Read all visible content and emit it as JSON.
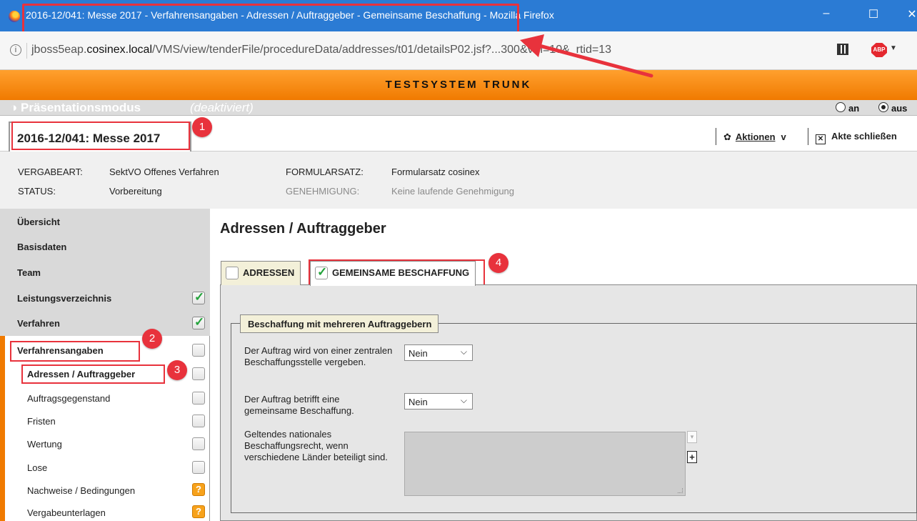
{
  "browser": {
    "window_title": "2016-12/041: Messe 2017 - Verfahrensangaben - Adressen / Auftraggeber - Gemeinsame Beschaffung - Mozilla Firefox",
    "window_buttons": {
      "minimize": "–",
      "maximize": "☐",
      "close": "✕"
    },
    "url_prefix": "jboss5eap.",
    "url_host": "cosinex.local",
    "url_path": "/VMS/view/tenderFile/procedureData/addresses/t01/detailsP02.jsf?...300&vm=10&_rtid=13",
    "info_icon": "ⓘ",
    "abp_label": "ABP"
  },
  "banner": {
    "text": "TESTSYSTEM TRUNK"
  },
  "presentation": {
    "label": "◑ Präsentationsmodus",
    "status": "(deaktiviert)",
    "option_on": "an",
    "option_off": "aus",
    "selected": "aus"
  },
  "file": {
    "title": "2016-12/041: Messe 2017",
    "actions_label": "Aktionen",
    "actions_caret": "v",
    "close_label": "Akte schließen"
  },
  "meta": {
    "vergabeart_label": "VERGABEART:",
    "vergabeart_value": "SektVO Offenes Verfahren",
    "status_label": "STATUS:",
    "status_value": "Vorbereitung",
    "formularsatz_label": "FORMULARSATZ:",
    "formularsatz_value": "Formularsatz cosinex",
    "genehmigung_label": "GENEHMIGUNG:",
    "genehmigung_value": "Keine laufende Genehmigung"
  },
  "sidebar": {
    "items": [
      {
        "label": "Übersicht"
      },
      {
        "label": "Basisdaten"
      },
      {
        "label": "Team"
      },
      {
        "label": "Leistungsverzeichnis",
        "state": "checked"
      },
      {
        "label": "Verfahren",
        "state": "checked"
      },
      {
        "label": "Verfahrensangaben",
        "state": "empty"
      },
      {
        "label": "Adressen / Auftraggeber",
        "state": "empty"
      },
      {
        "label": "Auftragsgegenstand",
        "state": "empty"
      },
      {
        "label": "Fristen",
        "state": "empty"
      },
      {
        "label": "Wertung",
        "state": "empty"
      },
      {
        "label": "Lose",
        "state": "empty"
      },
      {
        "label": "Nachweise / Bedingungen",
        "state": "warning",
        "symbol": "?"
      },
      {
        "label": "Vergabeunterlagen",
        "state": "warning",
        "symbol": "?"
      }
    ]
  },
  "main": {
    "title": "Adressen / Auftraggeber",
    "tabs": [
      {
        "label": "ADRESSEN",
        "checked": false
      },
      {
        "label": "GEMEINSAME BESCHAFFUNG",
        "checked": true
      }
    ],
    "fieldset_legend": "Beschaffung mit mehreren Auftraggebern",
    "fields": [
      {
        "label": "Der Auftrag wird von einer zentralen Beschaffungsstelle vergeben.",
        "value": "Nein"
      },
      {
        "label": "Der Auftrag betrifft eine gemeinsame Beschaffung.",
        "value": "Nein"
      },
      {
        "label": "Geltendes nationales Beschaffungsrecht, wenn verschiedene Länder beteiligt sind.",
        "value": ""
      }
    ]
  },
  "annotations": {
    "badges": [
      "1",
      "2",
      "3",
      "4"
    ],
    "color": "#e8323c"
  },
  "colors": {
    "titlebar": "#2b7bd4",
    "banner": "#f07a00",
    "check": "#22a23a",
    "warning": "#f7a21b"
  }
}
